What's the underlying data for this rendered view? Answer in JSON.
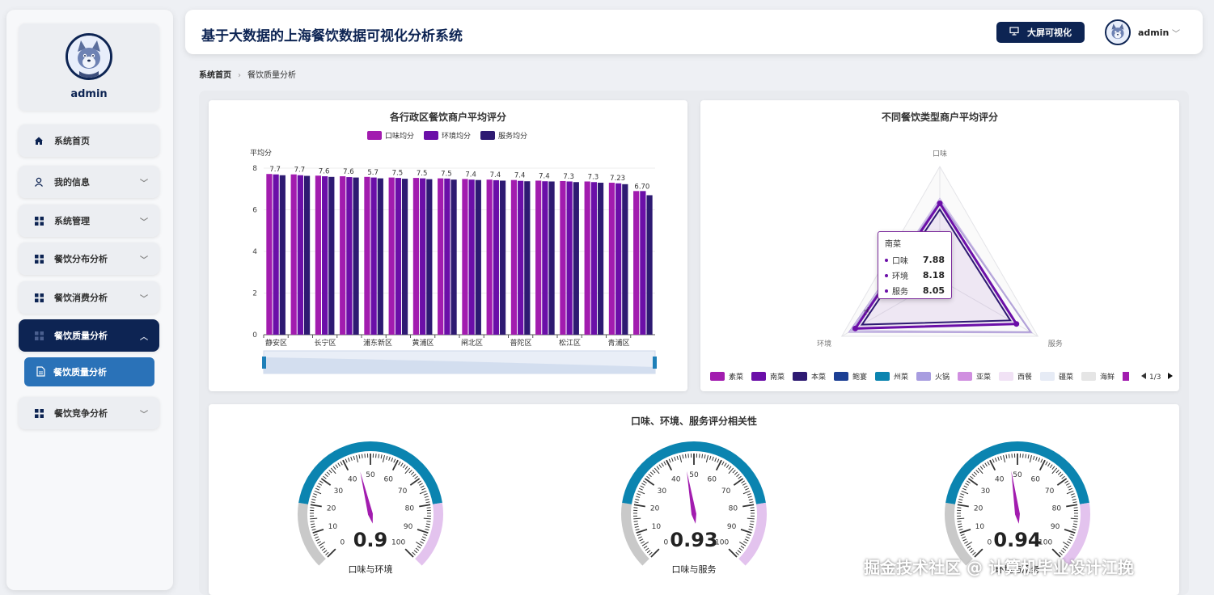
{
  "app": {
    "title": "基于大数据的上海餐饮数据可视化分析系统",
    "bigscreen_label": "大屏可视化",
    "user": "admin"
  },
  "sidebar": {
    "profile_name": "admin",
    "items": [
      {
        "label": "系统首页",
        "icon": "home-icon"
      },
      {
        "label": "我的信息",
        "icon": "user-icon"
      },
      {
        "label": "系统管理",
        "icon": "grid-icon"
      },
      {
        "label": "餐饮分布分析",
        "icon": "grid-icon"
      },
      {
        "label": "餐饮消费分析",
        "icon": "grid-icon"
      },
      {
        "label": "餐饮质量分析",
        "icon": "grid-icon"
      },
      {
        "label": "餐饮竞争分析",
        "icon": "grid-icon"
      }
    ],
    "sub_item": {
      "label": "餐饮质量分析",
      "icon": "document-icon"
    }
  },
  "breadcrumb": {
    "home": "系统首页",
    "current": "餐饮质量分析"
  },
  "colors": {
    "taste": "#a21caf",
    "env": "#6b0fa8",
    "service": "#2e1a72",
    "navy": "#0d2453",
    "gauge_blue": "#0b84b0",
    "gauge_pink": "#e3c3ee",
    "gauge_gray": "#c9c9c9"
  },
  "chart_data": [
    {
      "type": "bar",
      "title": "各行政区餐饮商户平均评分",
      "ylabel": "平均分",
      "ylim": [
        0,
        8
      ],
      "yticks": [
        0,
        2,
        4,
        6,
        8
      ],
      "categories": [
        "静安区",
        "",
        "长宁区",
        "",
        "浦东新区",
        "",
        "黄浦区",
        "",
        "闸北区",
        "",
        "普陀区",
        "",
        "松江区",
        "",
        "青浦区",
        ""
      ],
      "series": [
        {
          "name": "口味均分",
          "values": [
            7.72,
            7.7,
            7.64,
            7.61,
            7.58,
            7.55,
            7.53,
            7.51,
            7.48,
            7.45,
            7.43,
            7.4,
            7.38,
            7.36,
            7.3,
            6.9
          ]
        },
        {
          "name": "环境均分",
          "values": [
            7.7,
            7.66,
            7.61,
            7.57,
            7.55,
            7.53,
            7.51,
            7.5,
            7.45,
            7.42,
            7.39,
            7.37,
            7.36,
            7.33,
            7.27,
            6.9
          ]
        },
        {
          "name": "服务均分",
          "values": [
            7.66,
            7.63,
            7.58,
            7.55,
            7.51,
            7.49,
            7.47,
            7.45,
            7.43,
            7.4,
            7.37,
            7.36,
            7.33,
            7.3,
            7.23,
            6.7
          ]
        }
      ],
      "data_labels_top": [
        "7.7",
        "7.7",
        "7.6",
        "7.6",
        "5.7",
        "7.5",
        "7.5",
        "7.5",
        "7.4",
        "7.4",
        "7.4",
        "7.4",
        "7.3",
        "7.3",
        "7.23",
        "6.70"
      ]
    },
    {
      "type": "radar",
      "title": "不同餐饮类型商户平均评分",
      "indicators": [
        "口味",
        "服务",
        "环境"
      ],
      "legend": [
        "素菜",
        "南菜",
        "本菜",
        "鲍宴",
        "州菜",
        "火锅",
        "亚菜",
        "西餐",
        "疆菜",
        "海鲜"
      ],
      "legend_page": "1/3",
      "series": [
        {
          "name": "南菜",
          "values": [
            7.88,
            8.05,
            8.18
          ]
        }
      ],
      "tooltip": {
        "name": "南菜",
        "rows": [
          {
            "label": "口味",
            "value": "7.88"
          },
          {
            "label": "环境",
            "value": "8.18"
          },
          {
            "label": "服务",
            "value": "8.05"
          }
        ]
      }
    },
    {
      "type": "gauge",
      "title": "口味、环境、服务评分相关性",
      "ticks": [
        "0",
        "10",
        "20",
        "30",
        "40",
        "50",
        "60",
        "70",
        "80",
        "90",
        "100"
      ],
      "gauges": [
        {
          "label": "口味与环境",
          "value": 0.9,
          "display": "0.9"
        },
        {
          "label": "口味与服务",
          "value": 0.93,
          "display": "0.93"
        },
        {
          "label": "环境与服务",
          "value": 0.94,
          "display": "0.94"
        }
      ]
    }
  ],
  "watermark": "掘金技术社区 @ 计算机毕业设计江挽"
}
